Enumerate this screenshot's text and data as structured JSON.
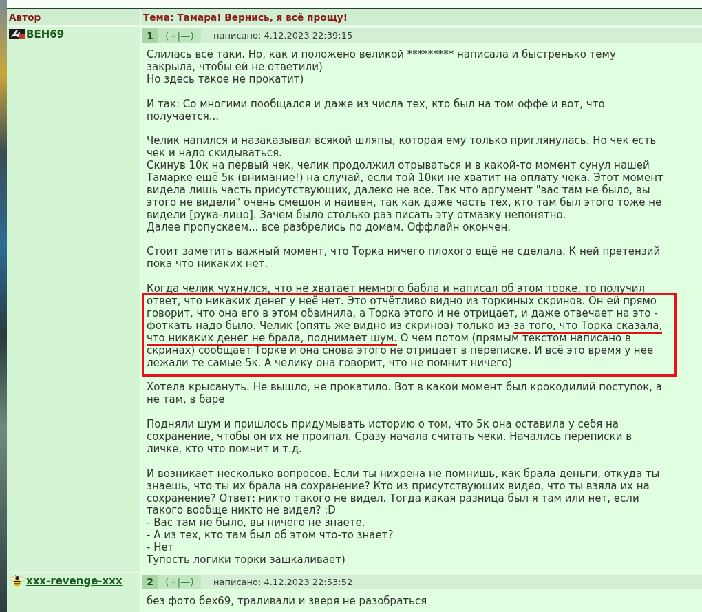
{
  "header": {
    "author_column": "Автор",
    "topic": "Тема: Тамара! Вернись, я всё прощу!"
  },
  "posts": [
    {
      "author": {
        "name": "BEH69",
        "avatar": {
          "kind": "picture"
        }
      },
      "number": "1",
      "vote": "(+|—)",
      "posted": "написано: 4.12.2023 22:39:15",
      "paragraphs": [
        {
          "kind": "plain",
          "lines": [
            "Слилась всё таки. Но, как и положено великой ********* написала и быстренько тему",
            "закрыла, чтобы ей не ответили)",
            "Но здесь такое не прокатит)"
          ]
        },
        {
          "kind": "plain",
          "lines": [
            "И так: Со многими пообщался и даже из числа тех, кто был на том оффе и вот, что",
            "получается..."
          ]
        },
        {
          "kind": "plain",
          "lines": [
            "Челик напился и назаказывал всякой шляпы, которая ему только приглянулась. Но чек есть",
            "чек и надо скидываться.",
            "Скинув 10к на первый чек, челик продолжил отрываться и в какой-то момент сунул нашей",
            "Тамарке ещё 5к (внимание!) на случай, если той 10ки не хватит на оплату чека. Этот момент",
            "видела лишь часть присутствующих, далеко не все. Так что аргумент \"вас там не было, вы",
            "этого не видели\" очень смешон и наивен, так как даже часть тех, кто там был этого тоже не",
            "видели [рука-лицо]. Зачем было столько раз писать эту отмазку непонятно.",
            "Далее пропускаем... все разбрелись по домам. Оффлайн окончен."
          ]
        },
        {
          "kind": "plain",
          "lines": [
            "Стоит заметить важный момент, что Торка ничего плохого ещё не сделала. К ней претензий",
            "пока что никаких нет."
          ]
        },
        {
          "kind": "marked",
          "lead": "Когда челик чухнулся, что не хватает немного бабла и написал об этом торке, то получил",
          "boxed_lines": [
            {
              "segments": [
                {
                  "kind": "plain",
                  "text": "ответ, что никаких денег у неё нет. Это отчётливо видно из торкиных скринов. Он ей прямо"
                }
              ]
            },
            {
              "segments": [
                {
                  "kind": "plain",
                  "text": "говорит, что она его в этом обвинила, а Торка этого и не отрицает, и даже отвечает на это -"
                }
              ]
            },
            {
              "segments": [
                {
                  "kind": "plain",
                  "text": "фоткать надо было. Челик (опять же видно из скринов) только из-"
                },
                {
                  "kind": "underlined",
                  "text": "за того, что Торка сказала,"
                }
              ]
            },
            {
              "segments": [
                {
                  "kind": "underlined",
                  "text": "что никаких денег не брала, поднимает шум."
                },
                {
                  "kind": "plain",
                  "text": " О чем потом (прямым текстом написано в"
                }
              ]
            },
            {
              "segments": [
                {
                  "kind": "plain",
                  "text": "скринах) сообщает Торке и она снова этого не отрицает в переписке. И всё это время у нее"
                }
              ]
            },
            {
              "segments": [
                {
                  "kind": "plain",
                  "text": "лежали те самые 5к. А челику она говорит, что не помнит ничего)"
                }
              ]
            }
          ]
        },
        {
          "kind": "plain",
          "lines": [
            "Хотела крысануть. Не вышло, не прокатило. Вот в какой момент был крокодилий поступок, а",
            "не там, в баре"
          ]
        },
        {
          "kind": "plain",
          "lines": [
            "Подняли шум и пришлось придумывать историю о том, что 5к она оставила у себя на",
            "сохранение, чтобы он их не проипал. Сразу начала считать чеки. Начались переписки в",
            "личке, кто что помнит и т.д."
          ]
        },
        {
          "kind": "plain",
          "lines": [
            "И возникает несколько вопросов. Если ты нихрена не помнишь, как брала деньги, откуда ты",
            "знаешь, что ты их брала на сохранение? Кто из присутствующих видео, что ты взяла их на",
            "сохранение? Ответ: никто такого не видел. Тогда какая разница был я там или нет, если",
            "такого вообще никто не видел? :D",
            "- Вас там не было, вы ничего не знаете.",
            "- А из тех, кто там был об этом что-то знает?",
            "- Нет",
            "Тупость логики торки зашкаливает)"
          ]
        }
      ]
    },
    {
      "author": {
        "name": "xxx-revenge-xxx",
        "avatar": {
          "kind": "bee"
        }
      },
      "number": "2",
      "vote": "(+|—)",
      "posted": "написано: 4.12.2023 22:53:52",
      "paragraphs": [
        {
          "kind": "plain",
          "lines": [
            "без фото бех69, траливали и зверя не разобраться"
          ]
        }
      ]
    }
  ]
}
